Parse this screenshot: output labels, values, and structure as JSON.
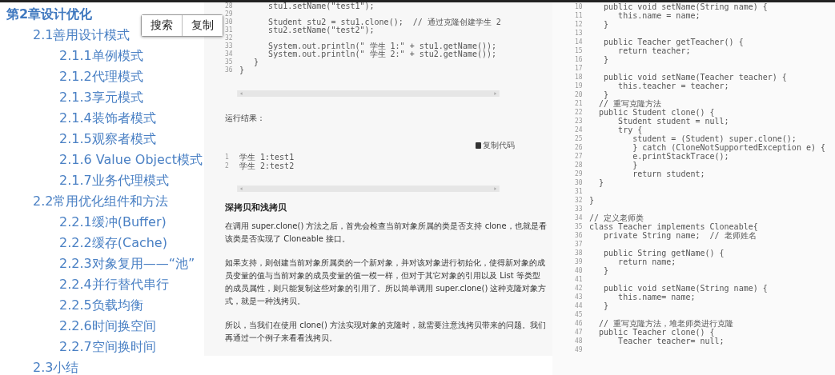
{
  "toc": {
    "title": "第2章设计优化",
    "items": [
      {
        "label": "2.1善用设计模式",
        "children": [
          {
            "label": "2.1.1单例模式"
          },
          {
            "label": "2.1.2代理模式"
          },
          {
            "label": "2.1.3享元模式"
          },
          {
            "label": "2.1.4装饰者模式"
          },
          {
            "label": "2.1.5观察者模式"
          },
          {
            "label": "2.1.6 Value Object模式"
          },
          {
            "label": "2.1.7业务代理模式"
          }
        ]
      },
      {
        "label": "2.2常用优化组件和方法",
        "children": [
          {
            "label": "2.2.1缓冲(Buffer)"
          },
          {
            "label": "2.2.2缓存(Cache)"
          },
          {
            "label": "2.2.3对象复用——“池”"
          },
          {
            "label": "2.2.4并行替代串行"
          },
          {
            "label": "2.2.5负载均衡"
          },
          {
            "label": "2.2.6时间换空间"
          },
          {
            "label": "2.2.7空间换时间"
          }
        ]
      },
      {
        "label": "2.3小结"
      }
    ]
  },
  "popup": {
    "buttons": [
      "搜索",
      "复制"
    ]
  },
  "article": {
    "code": [
      {
        "number": "28",
        "code": "      stu1.setName(\"test1\");"
      },
      {
        "number": "29"
      },
      {
        "number": "30",
        "code": "      Student stu2 = stu1.clone();  // 通过克隆创建学生 2"
      },
      {
        "number": "31",
        "code": "      stu2.setName(\"test2\");"
      },
      {
        "number": "32"
      },
      {
        "number": "33",
        "code": "      System.out.println(\" 学生 1:\" + stu1.getName());"
      },
      {
        "number": "34",
        "code": "      System.out.println(\" 学生 2:\" + stu2.getName());"
      },
      {
        "number": "35",
        "code": "   }"
      },
      {
        "number": "36",
        "code": "}"
      }
    ],
    "result_label": "运行结果：",
    "copy_code": "复制代码",
    "output": [
      {
        "number": "1",
        "code": "学生 1:test1"
      },
      {
        "number": "2",
        "code": "学生 2:test2"
      }
    ],
    "heading": "深拷贝和浅拷贝",
    "paragraphs": [
      "在调用 super.clone() 方法之后，首先会检查当前对象所属的类是否支持 clone，也就是看该类是否实现了 Cloneable 接口。",
      "如果支持，则创建当前对象所属类的一个新对象，并对该对象进行初始化，使得新对象的成员变量的值与当前对象的成员变量的值一模一样，但对于其它对象的引用以及 List 等类型的成员属性，则只能复制这些对象的引用了。所以简单调用 super.clone() 这种克隆对象方式，就是一种浅拷贝。",
      "所以，当我们在使用 clone() 方法实现对象的克隆时，就需要注意浅拷贝带来的问题。我们再通过一个例子来看看浅拷贝。"
    ]
  },
  "right_code": [
    {
      "number": "10",
      "code": "   public void setName(String name) {"
    },
    {
      "number": "11",
      "code": "      this.name = name;"
    },
    {
      "number": "12",
      "code": "   }"
    },
    {
      "number": "13"
    },
    {
      "number": "14",
      "code": "   public Teacher getTeacher() {"
    },
    {
      "number": "15",
      "code": "      return teacher;"
    },
    {
      "number": "16",
      "code": "   }"
    },
    {
      "number": "17"
    },
    {
      "number": "18",
      "code": "   public void setName(Teacher teacher) {"
    },
    {
      "number": "19",
      "code": "      this.teacher = teacher;"
    },
    {
      "number": "20",
      "code": "   }"
    },
    {
      "number": "21",
      "code": "  // 重写克隆方法"
    },
    {
      "number": "22",
      "code": "  public Student clone() {"
    },
    {
      "number": "23",
      "code": "      Student student = null;"
    },
    {
      "number": "24",
      "code": "      try {"
    },
    {
      "number": "25",
      "code": "         student = (Student) super.clone();"
    },
    {
      "number": "26",
      "code": "         } catch (CloneNotSupportedException e) {"
    },
    {
      "number": "27",
      "code": "         e.printStackTrace();"
    },
    {
      "number": "28",
      "code": "         }"
    },
    {
      "number": "29",
      "code": "         return student;"
    },
    {
      "number": "30",
      "code": "  }"
    },
    {
      "number": "31"
    },
    {
      "number": "32",
      "code": "}"
    },
    {
      "number": "33"
    },
    {
      "number": "34",
      "code": "// 定义老师类"
    },
    {
      "number": "35",
      "code": "class Teacher implements Cloneable{"
    },
    {
      "number": "36",
      "code": "   private String name;  // 老师姓名"
    },
    {
      "number": "37"
    },
    {
      "number": "38",
      "code": "   public String getName() {"
    },
    {
      "number": "39",
      "code": "      return name;"
    },
    {
      "number": "40",
      "code": "   }"
    },
    {
      "number": "41"
    },
    {
      "number": "42",
      "code": "   public void setName(String name) {"
    },
    {
      "number": "43",
      "code": "      this.name= name;"
    },
    {
      "number": "44",
      "code": "   }"
    },
    {
      "number": "45"
    },
    {
      "number": "46",
      "code": "  // 重写克隆方法，堆老师类进行克隆"
    },
    {
      "number": "47",
      "code": "  public Teacher clone() {"
    },
    {
      "number": "48",
      "code": "      Teacher teacher= null;"
    },
    {
      "number": "49"
    }
  ]
}
